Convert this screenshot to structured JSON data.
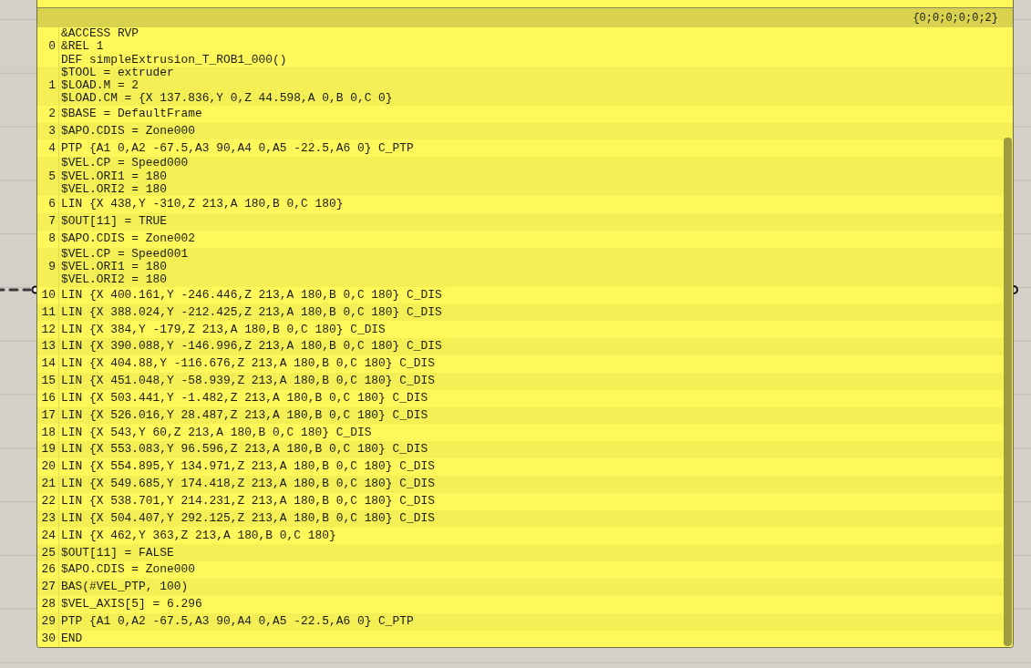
{
  "panel": {
    "path": "{0;0;0;0;0;2}",
    "items": [
      {
        "index": "0",
        "lines": [
          "&ACCESS RVP",
          "&REL 1",
          "DEF simpleExtrusion_T_ROB1_000()"
        ]
      },
      {
        "index": "1",
        "lines": [
          "$TOOL = extruder",
          "$LOAD.M = 2",
          "$LOAD.CM = {X 137.836,Y 0,Z 44.598,A 0,B 0,C 0}"
        ]
      },
      {
        "index": "2",
        "lines": [
          "$BASE = DefaultFrame"
        ]
      },
      {
        "index": "3",
        "lines": [
          "$APO.CDIS = Zone000"
        ]
      },
      {
        "index": "4",
        "lines": [
          "PTP {A1 0,A2 -67.5,A3 90,A4 0,A5 -22.5,A6 0} C_PTP"
        ]
      },
      {
        "index": "5",
        "lines": [
          "$VEL.CP = Speed000",
          "$VEL.ORI1 = 180",
          "$VEL.ORI2 = 180"
        ]
      },
      {
        "index": "6",
        "lines": [
          "LIN {X 438,Y -310,Z 213,A 180,B 0,C 180}"
        ]
      },
      {
        "index": "7",
        "lines": [
          "$OUT[11] = TRUE"
        ]
      },
      {
        "index": "8",
        "lines": [
          "$APO.CDIS = Zone002"
        ]
      },
      {
        "index": "9",
        "lines": [
          "$VEL.CP = Speed001",
          "$VEL.ORI1 = 180",
          "$VEL.ORI2 = 180"
        ]
      },
      {
        "index": "10",
        "lines": [
          "LIN {X 400.161,Y -246.446,Z 213,A 180,B 0,C 180} C_DIS"
        ]
      },
      {
        "index": "11",
        "lines": [
          "LIN {X 388.024,Y -212.425,Z 213,A 180,B 0,C 180} C_DIS"
        ]
      },
      {
        "index": "12",
        "lines": [
          "LIN {X 384,Y -179,Z 213,A 180,B 0,C 180} C_DIS"
        ]
      },
      {
        "index": "13",
        "lines": [
          "LIN {X 390.088,Y -146.996,Z 213,A 180,B 0,C 180} C_DIS"
        ]
      },
      {
        "index": "14",
        "lines": [
          "LIN {X 404.88,Y -116.676,Z 213,A 180,B 0,C 180} C_DIS"
        ]
      },
      {
        "index": "15",
        "lines": [
          "LIN {X 451.048,Y -58.939,Z 213,A 180,B 0,C 180} C_DIS"
        ]
      },
      {
        "index": "16",
        "lines": [
          "LIN {X 503.441,Y -1.482,Z 213,A 180,B 0,C 180} C_DIS"
        ]
      },
      {
        "index": "17",
        "lines": [
          "LIN {X 526.016,Y 28.487,Z 213,A 180,B 0,C 180} C_DIS"
        ]
      },
      {
        "index": "18",
        "lines": [
          "LIN {X 543,Y 60,Z 213,A 180,B 0,C 180} C_DIS"
        ]
      },
      {
        "index": "19",
        "lines": [
          "LIN {X 553.083,Y 96.596,Z 213,A 180,B 0,C 180} C_DIS"
        ]
      },
      {
        "index": "20",
        "lines": [
          "LIN {X 554.895,Y 134.971,Z 213,A 180,B 0,C 180} C_DIS"
        ]
      },
      {
        "index": "21",
        "lines": [
          "LIN {X 549.685,Y 174.418,Z 213,A 180,B 0,C 180} C_DIS"
        ]
      },
      {
        "index": "22",
        "lines": [
          "LIN {X 538.701,Y 214.231,Z 213,A 180,B 0,C 180} C_DIS"
        ]
      },
      {
        "index": "23",
        "lines": [
          "LIN {X 504.407,Y 292.125,Z 213,A 180,B 0,C 180} C_DIS"
        ]
      },
      {
        "index": "24",
        "lines": [
          "LIN {X 462,Y 363,Z 213,A 180,B 0,C 180}"
        ]
      },
      {
        "index": "25",
        "lines": [
          "$OUT[11] = FALSE"
        ]
      },
      {
        "index": "26",
        "lines": [
          "$APO.CDIS = Zone000"
        ]
      },
      {
        "index": "27",
        "lines": [
          "BAS(#VEL_PTP, 100)"
        ]
      },
      {
        "index": "28",
        "lines": [
          "$VEL_AXIS[5] = 6.296"
        ]
      },
      {
        "index": "29",
        "lines": [
          "PTP {A1 0,A2 -67.5,A3 90,A4 0,A5 -22.5,A6 0} C_PTP"
        ]
      },
      {
        "index": "30",
        "lines": [
          "END"
        ]
      }
    ]
  }
}
